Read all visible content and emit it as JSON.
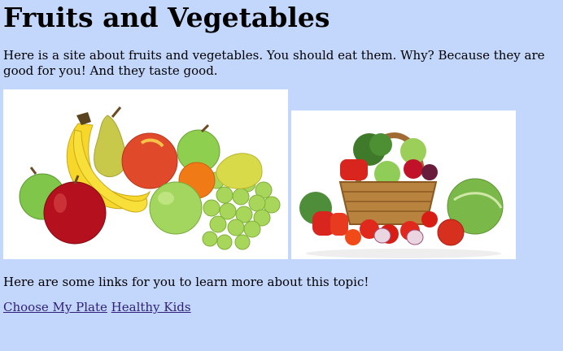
{
  "page": {
    "title": "Fruits and Vegetables",
    "intro": "Here is a site about fruits and vegetables. You should eat them. Why? Because they are good for you! And they taste good.",
    "links_text": "Here are some links for you to learn more about this topic!",
    "links": [
      {
        "label": "Choose My Plate"
      },
      {
        "label": "Healthy Kids"
      }
    ]
  },
  "colors": {
    "background": "#c3d6fb",
    "link": "#2f1f7a"
  },
  "images": [
    {
      "name": "fruits-image",
      "depicts": "assorted fruits: apples, bananas, pears, orange, grapes"
    },
    {
      "name": "vegetables-image",
      "depicts": "wicker basket of vegetables: broccoli, peppers, tomatoes, cabbage, onions"
    }
  ]
}
